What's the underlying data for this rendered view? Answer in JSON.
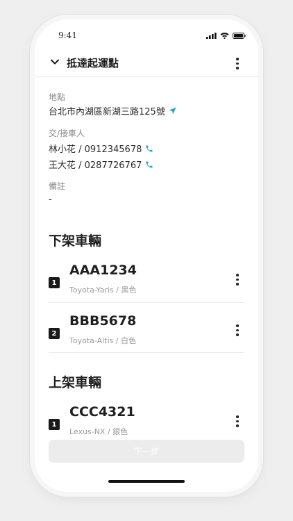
{
  "status": {
    "time": "9:41"
  },
  "header": {
    "title": "抵達起運點"
  },
  "location": {
    "label": "地點",
    "address": "台北市內湖區新湖三路125號"
  },
  "contacts": {
    "label": "交/接車人",
    "people": [
      {
        "text": "林小花 / 0912345678"
      },
      {
        "text": "王大花 / 0287726767"
      }
    ]
  },
  "note": {
    "label": "備註",
    "value": "-"
  },
  "unload": {
    "title": "下架車輛",
    "vehicles": [
      {
        "index": "1",
        "plate": "AAA1234",
        "model": "Toyota-Yaris / 黑色"
      },
      {
        "index": "2",
        "plate": "BBB5678",
        "model": "Toyota-Altis / 白色"
      }
    ]
  },
  "load": {
    "title": "上架車輛",
    "vehicles": [
      {
        "index": "1",
        "plate": "CCC4321",
        "model": "Lexus-NX / 銀色"
      }
    ]
  },
  "footer": {
    "next_label": "下一步"
  },
  "colors": {
    "accent": "#2a9fd8",
    "button_disabled": "#ececec"
  },
  "icons": {
    "navigate": "navigation-arrow-icon",
    "phone": "phone-icon",
    "back": "chevron-down-icon",
    "more": "more-vertical-icon"
  }
}
